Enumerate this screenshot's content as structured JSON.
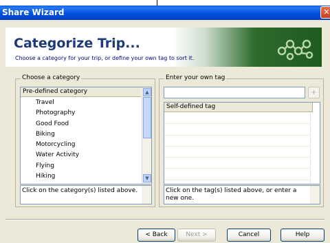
{
  "window": {
    "title": "Share Wizard",
    "close_glyph": "✕"
  },
  "banner": {
    "title": "Categorize Trip...",
    "subtitle": "Choose a category for your trip, or define your own tag to sort it.",
    "icon": "molecule-chain-icon"
  },
  "category_group": {
    "label": "Choose a category",
    "header": "Pre-defined category",
    "items": [
      "Travel",
      "Photography",
      "Good Food",
      "Biking",
      "Motorcycling",
      "Water Activity",
      "Flying",
      "Hiking"
    ],
    "hint": "Click on the category(s) listed above."
  },
  "tag_group": {
    "label": "Enter your own tag",
    "input_value": "",
    "add_glyph": "+",
    "header": "Self-defined tag",
    "hint": "Click on the tag(s) listed above, or enter a new one."
  },
  "buttons": {
    "back": "< Back",
    "next": "Next >",
    "cancel": "Cancel",
    "help": "Help"
  },
  "colors": {
    "title_bar": "#0046d0",
    "banner_title": "#1e3a78",
    "face": "#ece9d8"
  }
}
